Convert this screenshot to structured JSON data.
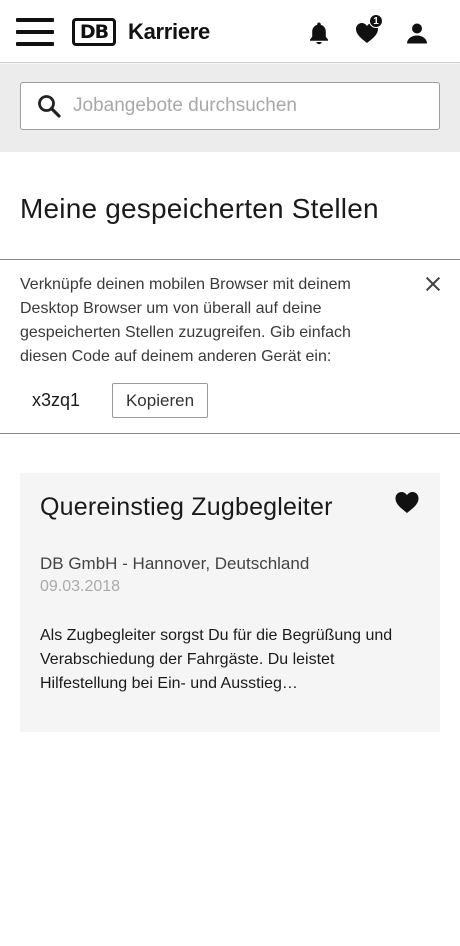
{
  "header": {
    "logo_text": "DB",
    "brand": "Karriere",
    "saved_count": "1",
    "icons": [
      "menu-icon",
      "bell-icon",
      "heart-icon",
      "user-icon"
    ]
  },
  "search": {
    "placeholder": "Jobangebote durchsuchen",
    "value": ""
  },
  "page": {
    "title": "Meine gespeicherten Stellen"
  },
  "sync": {
    "text": "Verknüpfe deinen mobilen Browser mit deinem Desktop Browser um von überall auf deine gespeicherten Stellen zuzugreifen. Gib einfach diesen Code auf deinem anderen Gerät ein:",
    "code": "x3zq1",
    "copy_label": "Kopieren"
  },
  "jobs": [
    {
      "title": "Quereinstieg Zugbegleiter",
      "company": "DB GmbH - Hannover, Deutschland",
      "date": "09.03.2018",
      "description": "Als Zugbegleiter sorgst Du für die Begrüßung und Verabschiedung der Fahrgäste. Du leistet Hilfestellung bei Ein- und Ausstieg…",
      "saved": true
    }
  ],
  "colors": {
    "text": "#1a1a1a",
    "search_band": "#ececec",
    "card_bg": "#f5f5f5",
    "muted": "#aaaaaa"
  }
}
